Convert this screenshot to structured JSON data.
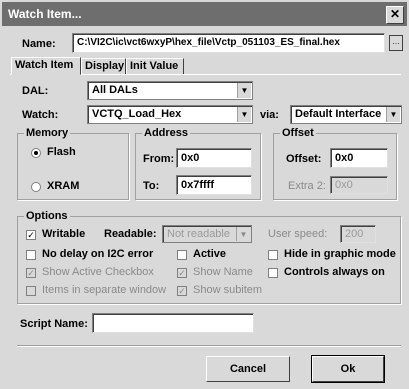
{
  "window": {
    "title": "Watch Item...",
    "close_glyph": "✕"
  },
  "name": {
    "label": "Name:",
    "value": "C:\\VI2C\\ic\\vct6wxyP\\hex_file\\Vctp_051103_ES_final.hex",
    "browse_glyph": "…"
  },
  "tabs": [
    {
      "label": "Watch Item"
    },
    {
      "label": "Display"
    },
    {
      "label": "Init Value"
    }
  ],
  "dal": {
    "label": "DAL:",
    "value": "All DALs"
  },
  "watch": {
    "label": "Watch:",
    "value": "VCTQ_Load_Hex",
    "via_label": "via:",
    "via_value": "Default Interface"
  },
  "memory": {
    "title": "Memory",
    "flash": "Flash",
    "xram": "XRAM",
    "selected": "Flash"
  },
  "address": {
    "title": "Address",
    "from_label": "From:",
    "from_value": "0x0",
    "to_label": "To:",
    "to_value": "0x7ffff"
  },
  "offset": {
    "title": "Offset",
    "offset_label": "Offset:",
    "offset_value": "0x0",
    "extra_label": "Extra 2:",
    "extra_value": "0x0"
  },
  "options": {
    "title": "Options",
    "writable": "Writable",
    "readable_label": "Readable:",
    "readable_value": "Not readable",
    "user_speed_label": "User speed:",
    "user_speed_value": "200",
    "no_delay": "No delay on I2C error",
    "active": "Active",
    "hide_graphic": "Hide in graphic mode",
    "show_active_checkbox": "Show Active Checkbox",
    "show_name": "Show Name",
    "controls_always_on": "Controls always on",
    "items_separate": "Items in separate window",
    "show_subitem": "Show subitem"
  },
  "script": {
    "label": "Script Name:",
    "value": ""
  },
  "buttons": {
    "cancel": "Cancel",
    "ok": "Ok"
  },
  "icons": {
    "check": "✓",
    "arrow": "▼"
  }
}
